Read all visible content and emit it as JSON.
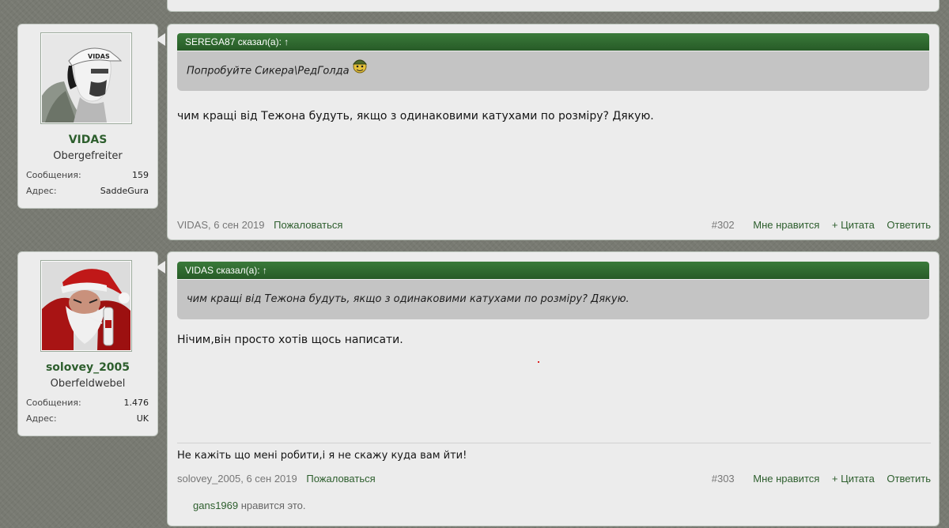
{
  "posts": [
    {
      "user": {
        "name": "VIDAS",
        "rank": "Obergefreiter",
        "stats": [
          {
            "label": "Сообщения:",
            "value": "159"
          },
          {
            "label": "Адрес:",
            "value": "SaddeGura"
          }
        ],
        "avatar_text": "VIDAS"
      },
      "quote": {
        "header": "SEREGA87 сказал(а): ↑",
        "text": "Попробуйте Сикера\\РедГолда"
      },
      "body": "чим кращі від Тежона будуть, якщо з одинаковими катухами по розміру? Дякую.",
      "meta": {
        "author_date": "VIDAS, 6 сен 2019",
        "report": "Пожаловаться",
        "number": "#302",
        "like": "Мне нравится",
        "quote_btn": "+ Цитата",
        "reply": "Ответить"
      }
    },
    {
      "user": {
        "name": "solovey_2005",
        "rank": "Oberfeldwebel",
        "stats": [
          {
            "label": "Сообщения:",
            "value": "1.476"
          },
          {
            "label": "Адрес:",
            "value": "UK"
          }
        ]
      },
      "quote": {
        "header": "VIDAS сказал(а): ↑",
        "text": "чим кращі від Тежона будуть, якщо з одинаковими катухами по розміру? Дякую."
      },
      "body": "Нічим,він просто хотів щось написати.",
      "signature": "Не кажіть що мені робити,і я не скажу куда вам йти!",
      "meta": {
        "author_date": "solovey_2005, 6 сен 2019",
        "report": "Пожаловаться",
        "number": "#303",
        "like": "Мне нравится",
        "quote_btn": "+ Цитата",
        "reply": "Ответить"
      },
      "likes": {
        "who": "gans1969",
        "text": " нравится это."
      }
    }
  ]
}
